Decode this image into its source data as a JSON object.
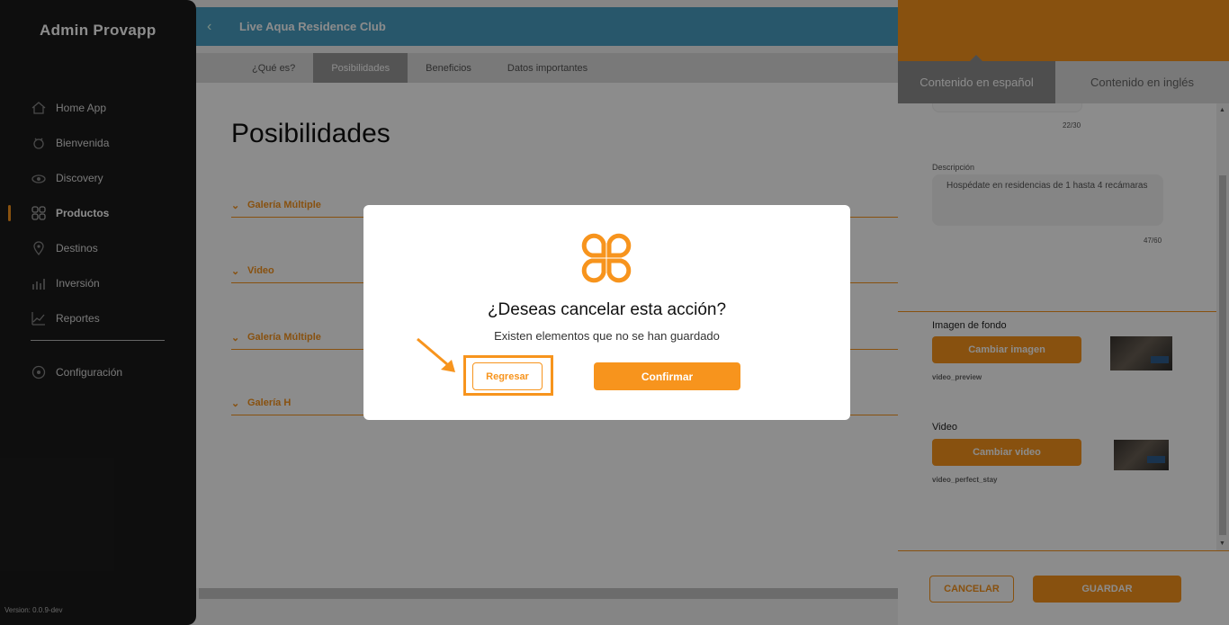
{
  "sidebar": {
    "brand": "Admin Provapp",
    "items": [
      {
        "label": "Home App",
        "icon": "home-icon"
      },
      {
        "label": "Bienvenida",
        "icon": "welcome-icon"
      },
      {
        "label": "Discovery",
        "icon": "eye-icon"
      },
      {
        "label": "Productos",
        "icon": "grid-icon",
        "active": true
      },
      {
        "label": "Destinos",
        "icon": "location-pin-icon"
      },
      {
        "label": "Inversión",
        "icon": "bar-chart-icon"
      },
      {
        "label": "Reportes",
        "icon": "line-chart-icon"
      }
    ],
    "config": {
      "label": "Configuración",
      "icon": "gear-icon"
    },
    "version": "Version: 0.0.9-dev"
  },
  "header": {
    "title": "Live Aqua Residence Club"
  },
  "tabs": [
    "¿Qué es?",
    "Posibilidades",
    "Beneficios",
    "Datos importantes"
  ],
  "main": {
    "title": "Posibilidades",
    "sections": [
      "Galería Múltiple",
      "Video",
      "Galería Múltiple",
      "Galería H"
    ]
  },
  "panel": {
    "tabs": [
      "Contenido en español",
      "Contenido en inglés"
    ],
    "counter_title": "22/30",
    "description_label": "Descripción",
    "description_value": "Hospédate en residencias de 1 hasta 4 recámaras",
    "counter_description": "47/60",
    "background_label": "Imagen de fondo",
    "change_image_label": "Cambiar imagen",
    "image_file": "video_preview",
    "video_label": "Video",
    "change_video_label": "Cambiar video",
    "video_file": "video_perfect_stay",
    "cancel_label": "CANCELAR",
    "save_label": "GUARDAR"
  },
  "modal": {
    "title": "¿Deseas cancelar esta acción?",
    "subtitle": "Existen elementos que no se han guardado",
    "back_label": "Regresar",
    "confirm_label": "Confirmar"
  },
  "colors": {
    "accent": "#f7941d",
    "sidebar": "#1b1b1b",
    "header": "#4a9fc4"
  }
}
